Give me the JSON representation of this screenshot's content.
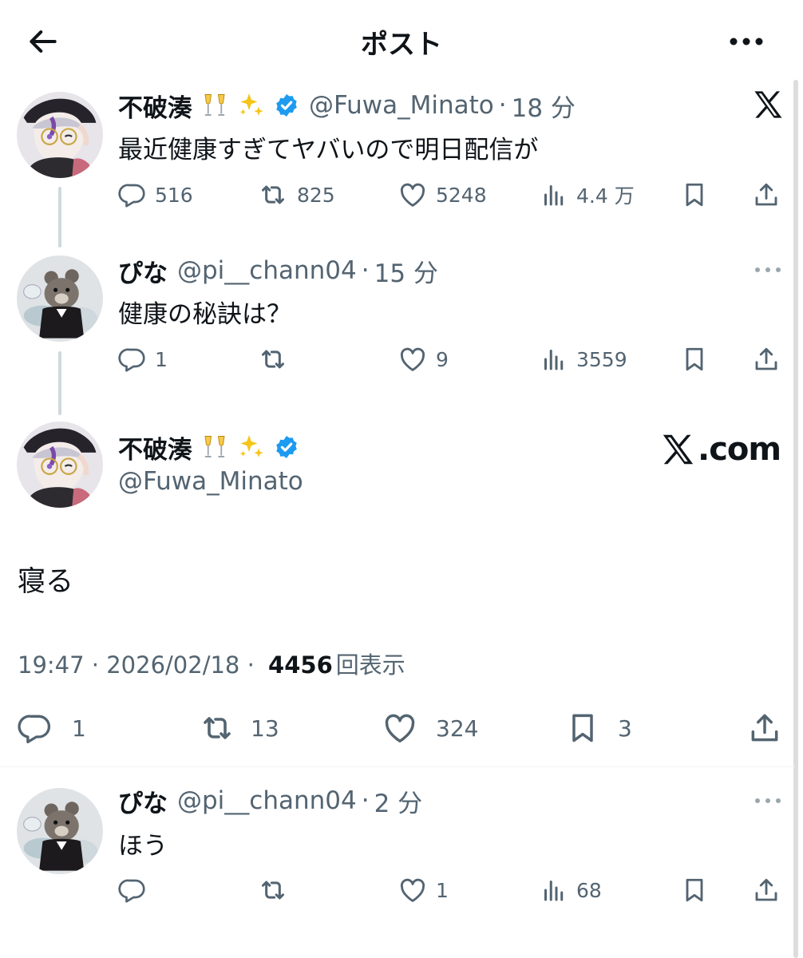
{
  "header": {
    "title": "ポスト"
  },
  "posts": [
    {
      "name": "不破湊",
      "emoji": [
        "🥂",
        "✨"
      ],
      "verified": true,
      "handle": "@Fuwa_Minato",
      "time": "18 分",
      "text": "最近健康すぎてヤバいので明日配信が",
      "counts": {
        "reply": "516",
        "repost": "825",
        "like": "5248",
        "views": "4.4 万"
      }
    },
    {
      "name": "ぴな",
      "handle": "@pi__chann04",
      "time": "15 分",
      "text": "健康の秘訣は？",
      "counts": {
        "reply": "1",
        "repost": "",
        "like": "9",
        "views": "3559"
      }
    }
  ],
  "focused": {
    "name": "不破湊",
    "emoji": [
      "🥂",
      "✨"
    ],
    "verified": true,
    "handle": "@Fuwa_Minato",
    "watermark": ".com",
    "text": "寝る",
    "time": "19:47",
    "date": "2026/02/18",
    "views": "4456",
    "views_label": "回表示",
    "counts": {
      "reply": "1",
      "repost": "13",
      "like": "324",
      "bookmark": "3"
    }
  },
  "replies": [
    {
      "name": "ぴな",
      "handle": "@pi__chann04",
      "time": "2 分",
      "text": "ほう",
      "counts": {
        "reply": "",
        "repost": "",
        "like": "1",
        "views": "68"
      }
    }
  ],
  "colors": {
    "text": "#0f1419",
    "secondary": "#536471",
    "verified": "#1d9bf0",
    "thread_line": "#cfd9de"
  }
}
